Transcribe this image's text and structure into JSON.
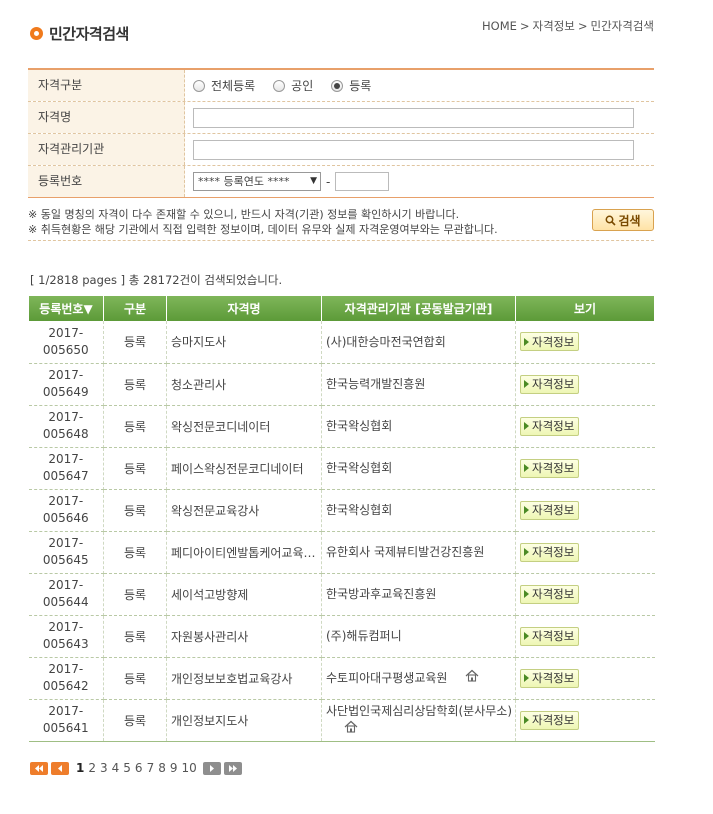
{
  "header": {
    "title": "민간자격검색",
    "breadcrumb": [
      "HOME",
      "자격정보",
      "민간자격검색"
    ],
    "breadcrumb_sep": ">"
  },
  "form": {
    "type_label": "자격구분",
    "type_options": [
      {
        "label": "전체등록",
        "checked": false
      },
      {
        "label": "공인",
        "checked": false
      },
      {
        "label": "등록",
        "checked": true
      }
    ],
    "name_label": "자격명",
    "name_value": "",
    "org_label": "자격관리기관",
    "org_value": "",
    "regno_label": "등록번호",
    "year_select": "**** 등록연도 ****",
    "regno_value": "",
    "dash": "-"
  },
  "notice": {
    "line1": "※ 동일 명칭의 자격이 다수 존재할 수 있으니, 반드시 자격(기관) 정보를 확인하시기 바랍니다.",
    "line2": "※ 취득현황은 해당 기관에서 직접 입력한 정보이며, 데이터 유무와 실제 자격운영여부와는 무관합니다.",
    "search_button": "검색"
  },
  "results": {
    "summary": "[ 1/2818 pages ] 총 28172건이 검색되었습니다.",
    "columns": [
      "등록번호▼",
      "구분",
      "자격명",
      "자격관리기관 [공동발급기관]",
      "보기"
    ],
    "view_label": "자격정보",
    "rows": [
      {
        "num1": "2017-",
        "num2": "005650",
        "type": "등록",
        "name": "승마지도사",
        "org": "(사)대한승마전국연합회",
        "home": false
      },
      {
        "num1": "2017-",
        "num2": "005649",
        "type": "등록",
        "name": "청소관리사",
        "org": "한국능력개발진흥원",
        "home": false
      },
      {
        "num1": "2017-",
        "num2": "005648",
        "type": "등록",
        "name": "왁싱전문코디네이터",
        "org": "한국왁싱협회",
        "home": false
      },
      {
        "num1": "2017-",
        "num2": "005647",
        "type": "등록",
        "name": "페이스왁싱전문코디네이터",
        "org": "한국왁싱협회",
        "home": false
      },
      {
        "num1": "2017-",
        "num2": "005646",
        "type": "등록",
        "name": "왁싱전문교육강사",
        "org": "한국왁싱협회",
        "home": false
      },
      {
        "num1": "2017-",
        "num2": "005645",
        "type": "등록",
        "name": "페디아이티엔발톱케어교육…",
        "org": "유한회사 국제뷰티발건강진흥원",
        "home": false
      },
      {
        "num1": "2017-",
        "num2": "005644",
        "type": "등록",
        "name": "세이석고방향제",
        "org": "한국방과후교육진흥원",
        "home": false
      },
      {
        "num1": "2017-",
        "num2": "005643",
        "type": "등록",
        "name": "자원봉사관리사",
        "org": "(주)해듀컴퍼니",
        "home": false
      },
      {
        "num1": "2017-",
        "num2": "005642",
        "type": "등록",
        "name": "개인정보보호법교육강사",
        "org": "수토피아대구평생교육원",
        "home": true
      },
      {
        "num1": "2017-",
        "num2": "005641",
        "type": "등록",
        "name": "개인정보지도사",
        "org": "사단법인국제심리상담학회(분사무소)",
        "home": true
      }
    ]
  },
  "pagination": {
    "pages": [
      "1",
      "2",
      "3",
      "4",
      "5",
      "6",
      "7",
      "8",
      "9",
      "10"
    ],
    "current": "1"
  },
  "colors": {
    "accent_orange": "#f07a1c",
    "header_green": "#5c9a38",
    "form_label_bg": "#fbf3e6"
  }
}
